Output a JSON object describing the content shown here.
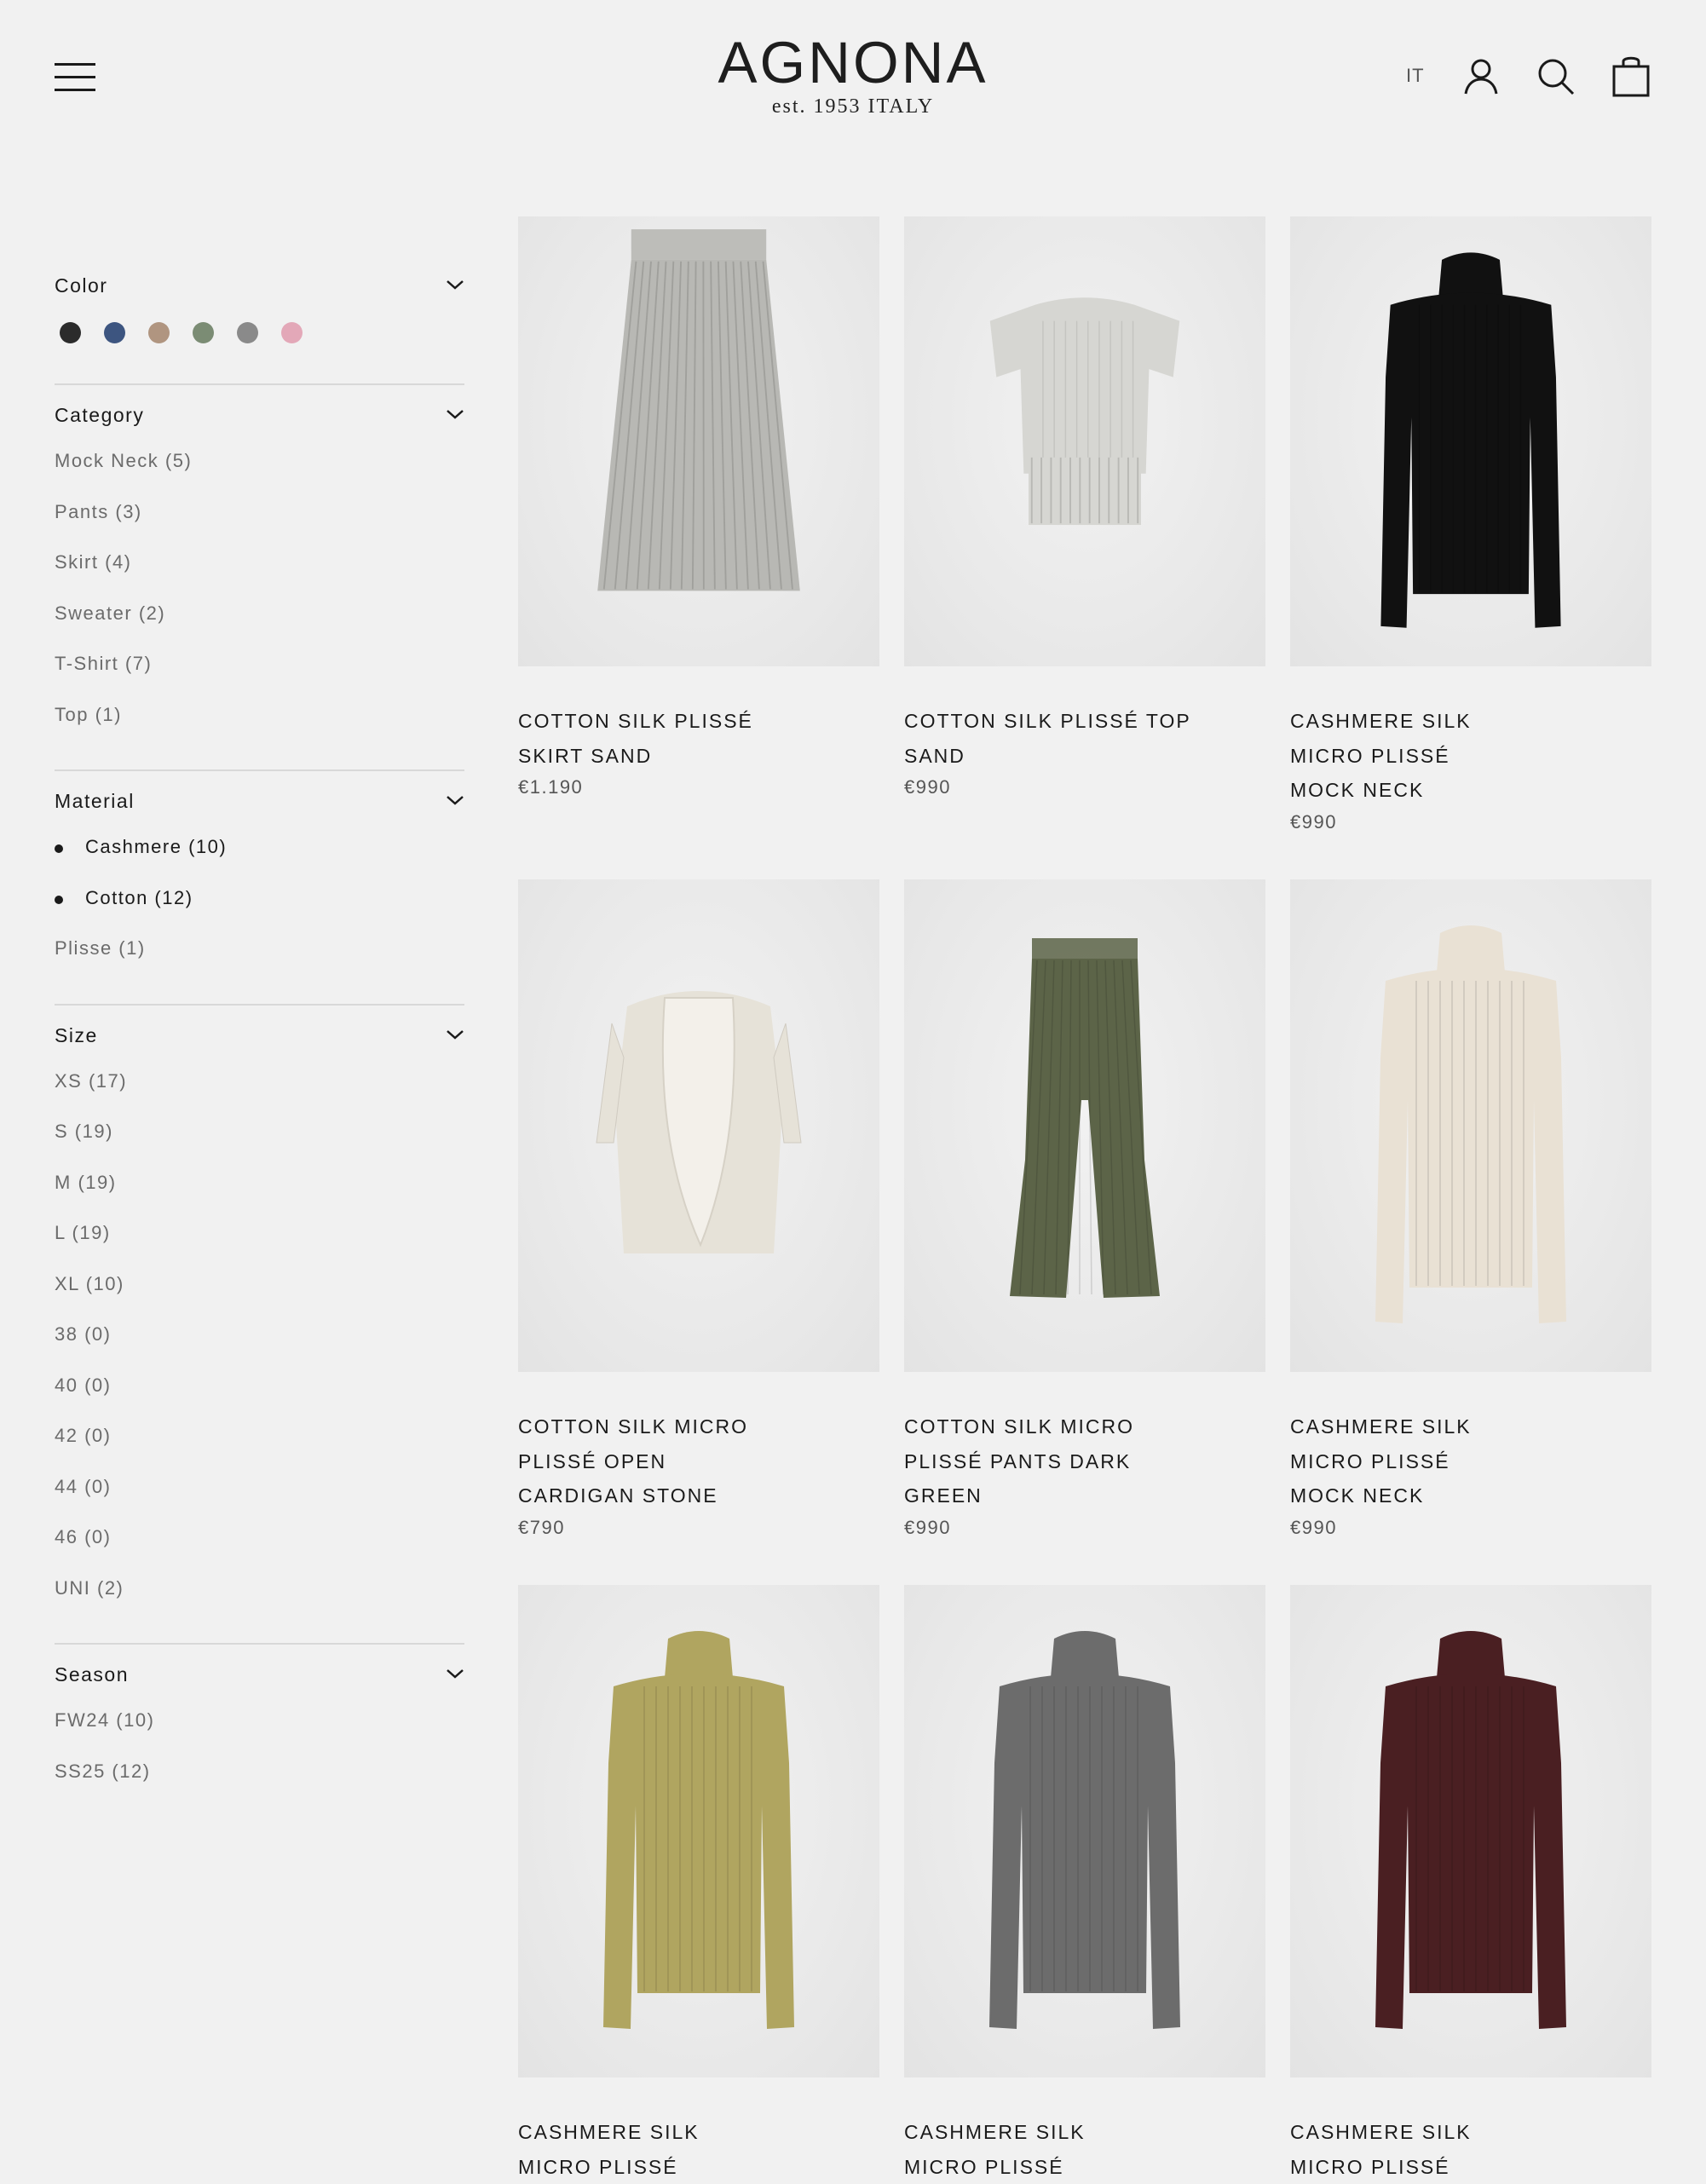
{
  "header": {
    "brand": "AGNONA",
    "brand_sub": "est. 1953 ITALY",
    "lang": "IT"
  },
  "filters": {
    "color": {
      "title": "Color",
      "swatches": [
        "#2b2b2b",
        "#3d5580",
        "#b09580",
        "#7b8c74",
        "#8a8a8a",
        "#e3a8b8"
      ]
    },
    "category": {
      "title": "Category",
      "options": [
        "Mock Neck (5)",
        "Pants (3)",
        "Skirt (4)",
        "Sweater (2)",
        "T-Shirt (7)",
        "Top (1)"
      ]
    },
    "material": {
      "title": "Material",
      "options": [
        "Cashmere (10)",
        "Cotton (12)",
        "Plisse (1)"
      ],
      "checked": [
        true,
        true,
        false
      ]
    },
    "size": {
      "title": "Size",
      "options": [
        "XS (17)",
        "S (19)",
        "M (19)",
        "L (19)",
        "XL (10)",
        "38 (0)",
        "40 (0)",
        "42 (0)",
        "44 (0)",
        "46 (0)",
        "UNI (2)"
      ]
    },
    "season": {
      "title": "Season",
      "options": [
        "FW24 (10)",
        "SS25 (12)"
      ]
    }
  },
  "products": [
    {
      "name_lines": [
        "COTTON SILK PLISSÉ",
        "SKIRT SAND"
      ],
      "price": "€1.190",
      "garment": "skirt",
      "color": "#b8b8b4"
    },
    {
      "name_lines": [
        "COTTON SILK PLISSÉ TOP",
        "SAND"
      ],
      "price": "€990",
      "garment": "top",
      "color": "#d6d6d2"
    },
    {
      "name_lines": [
        "CASHMERE SILK",
        "MICRO PLISSÉ",
        "MOCK NECK"
      ],
      "price": "€990",
      "garment": "mockneck",
      "color": "#111111"
    },
    {
      "name_lines": [
        "COTTON SILK MICRO",
        "PLISSÉ OPEN",
        "CARDIGAN STONE"
      ],
      "price": "€790",
      "garment": "cardigan",
      "color": "#e6e2d8"
    },
    {
      "name_lines": [
        "COTTON SILK MICRO",
        "PLISSÉ PANTS DARK",
        "GREEN"
      ],
      "price": "€990",
      "garment": "pants",
      "color": "#5c6448"
    },
    {
      "name_lines": [
        "CASHMERE SILK",
        "MICRO PLISSÉ",
        "MOCK NECK"
      ],
      "price": "€990",
      "garment": "mockneck",
      "color": "#e9e1d4"
    },
    {
      "name_lines": [
        "CASHMERE SILK",
        "MICRO PLISSÉ"
      ],
      "price": "",
      "garment": "mockneck",
      "color": "#b0a560"
    },
    {
      "name_lines": [
        "CASHMERE SILK",
        "MICRO PLISSÉ"
      ],
      "price": "",
      "garment": "mockneck",
      "color": "#6c6c6c"
    },
    {
      "name_lines": [
        "CASHMERE SILK",
        "MICRO PLISSÉ"
      ],
      "price": "",
      "garment": "mockneck",
      "color": "#4a1f22"
    }
  ]
}
